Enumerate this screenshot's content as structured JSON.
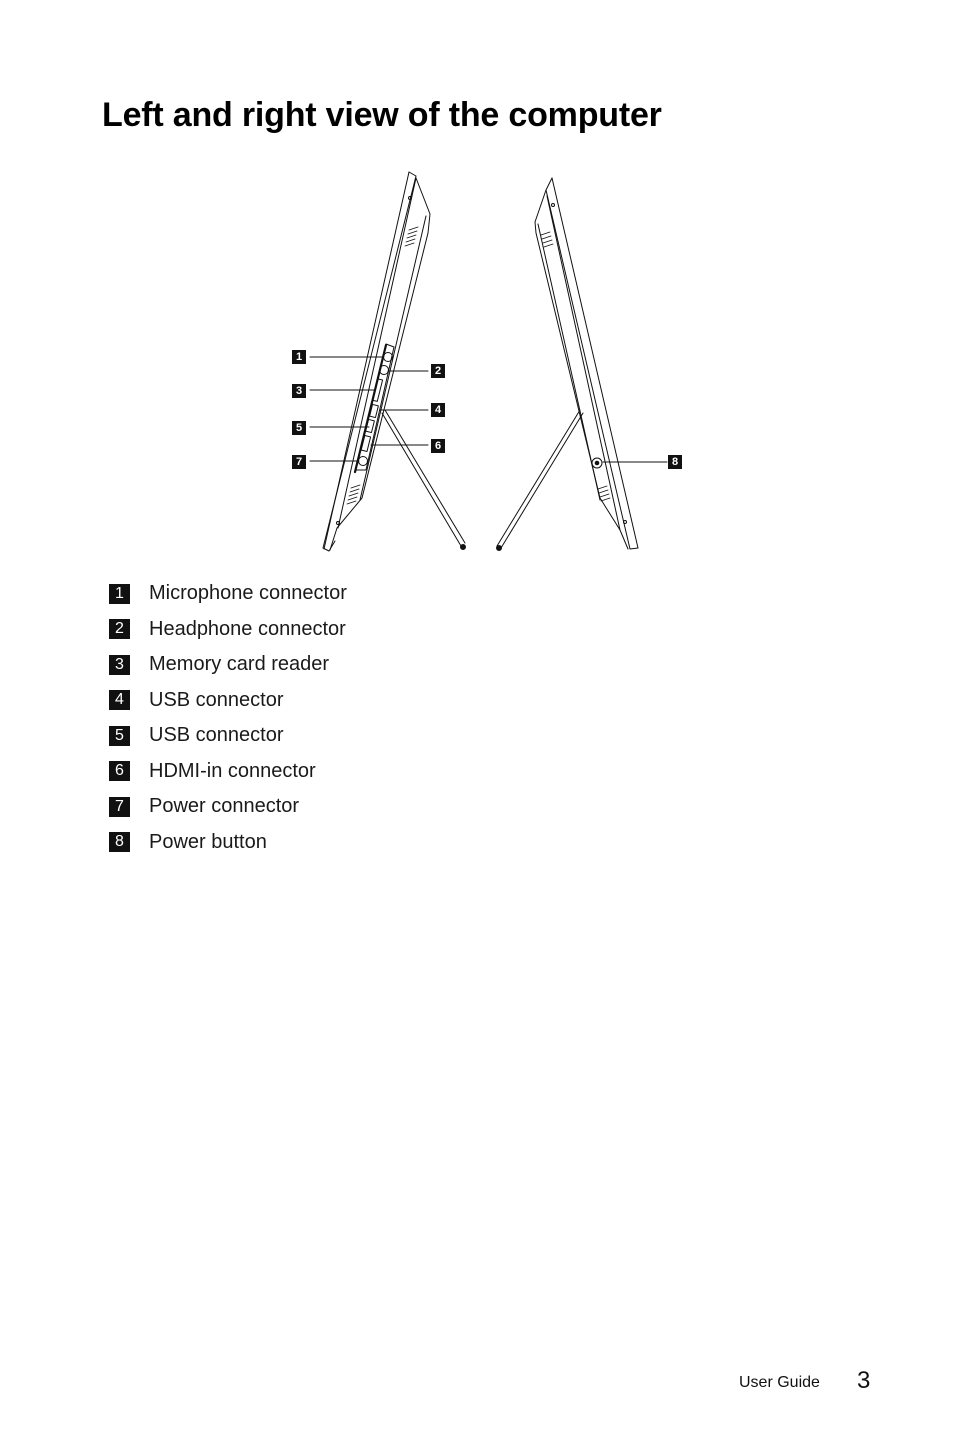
{
  "page": {
    "title": "Left and right view of the computer"
  },
  "figure": {
    "left_view_callouts": [
      "1",
      "2",
      "3",
      "4",
      "5",
      "6",
      "7"
    ],
    "right_view_callouts": [
      "8"
    ]
  },
  "legend": {
    "items": [
      {
        "number": "1",
        "label": "Microphone connector"
      },
      {
        "number": "2",
        "label": "Headphone connector"
      },
      {
        "number": "3",
        "label": "Memory card reader"
      },
      {
        "number": "4",
        "label": "USB connector"
      },
      {
        "number": "5",
        "label": "USB connector"
      },
      {
        "number": "6",
        "label": "HDMI-in connector"
      },
      {
        "number": "7",
        "label": "Power connector"
      },
      {
        "number": "8",
        "label": "Power button"
      }
    ]
  },
  "footer": {
    "document_name": "User Guide",
    "page_number": "3"
  }
}
